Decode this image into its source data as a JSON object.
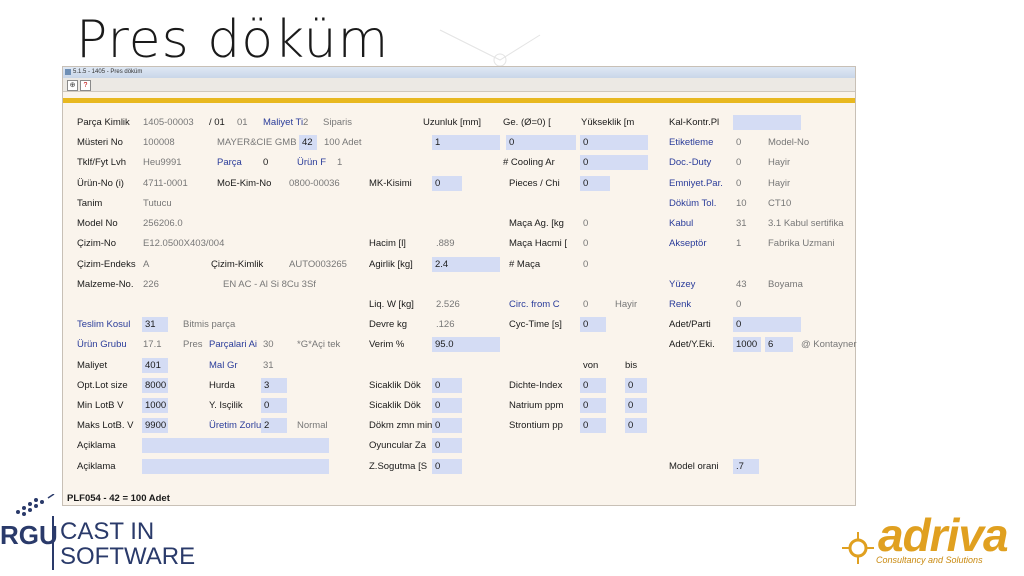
{
  "slide": {
    "title": "Pres döküm"
  },
  "window": {
    "title": "5.1.5 - 1405 - Pres döküm"
  },
  "toolbar": {
    "btn1": "⊕",
    "btn2": "?"
  },
  "labels": {
    "parca_kimlik": "Parça Kimlik",
    "musteri_no": "Müsteri No",
    "tklf_fyt_lvh": "Tklf/Fyt Lvh",
    "urun_no": "Ürün-No (i)",
    "tanim": "Tanim",
    "model_no": "Model No",
    "cizim_no": "Çizim-No",
    "cizim_endeks": "Çizim-Endeks",
    "malzeme_no": "Malzeme-No.",
    "teslim_kosul": "Teslim Kosul",
    "urun_grubu": "Ürün Grubu",
    "maliyet": "Maliyet",
    "opt_lot": "Opt.Lot size",
    "min_lot": "Min LotB V",
    "maks_lot": "Maks LotB. V",
    "aciklama1": "Açiklama",
    "aciklama2": "Açiklama",
    "maliyet_ti": "Maliyet Ti",
    "moe_kim": "MoE-Kim-No",
    "parca": "Parça",
    "urun_f": "Ürün F",
    "cizim_kimlik": "Çizim-Kimlik",
    "parcalari_ai": "Parçalari Ai",
    "mal_gr": "Mal Gr",
    "hurda": "Hurda",
    "y_iscilik": "Y. Isçilik",
    "uretim_zorlu": "Üretim Zorlu",
    "uzunluk": "Uzunluk [mm]",
    "mk_kisimi": "MK-Kisimi",
    "hacim": "Hacim [l]",
    "agirlik": "Agirlik [kg]",
    "liq_w": "Liq. W [kg]",
    "devre_kg": "Devre kg",
    "verim": "Verim %",
    "sicaklik1": "Sicaklik Dök",
    "sicaklik2": "Sicaklik Dök",
    "dokm_zmn": "Dökm zmn min",
    "oyuncular": "Oyuncular Za",
    "z_sogutma": "Z.Sogutma [S",
    "ge": "Ge.  (Ø=0) [",
    "cooling": "# Cooling Ar",
    "pieces": "Pieces / Chi",
    "maca_ag": "Maça Ag. [kg",
    "maca_hacmi": "Maça Hacmi [",
    "maca": "# Maça",
    "circ": "Circ. from C",
    "cyc_time": "Cyc-Time [s]",
    "dichte": "Dichte-Index",
    "natrium": "Natrium ppm",
    "strontium": "Strontium pp",
    "von": "von",
    "bis": "bis",
    "yukseklik": "Yükseklik [m",
    "kal_kontr": "Kal-Kontr.Pl",
    "etiketleme": "Etiketleme",
    "doc_duty": "Doc.-Duty",
    "emniyet": "Emniyet.Par.",
    "dokum_tol": "Döküm Tol.",
    "kabul": "Kabul",
    "akseptor": "Akseptör",
    "yuzey": "Yüzey",
    "renk": "Renk",
    "adet_parti": "Adet/Parti",
    "adet_y_eki": "Adet/Y.Eki.",
    "model_orani": "Model orani"
  },
  "values": {
    "parca_kimlik": "1405-00003",
    "parca_kimlik_2": "/ 01",
    "parca_kimlik_3": "01",
    "maliyet_ti_suffix": "2",
    "siparis": "Siparis",
    "musteri_no": "100008",
    "musteri_name": "MAYER&CIE GMB",
    "musteri_qty": "42",
    "adet": "100 Adet",
    "tklf": "Heu9991",
    "parca_val": "0",
    "urun_f_val": "1",
    "urun_no": "4711-0001",
    "moe_kim": "0800-00036",
    "tanim": "Tutucu",
    "model_no": "256206.0",
    "cizim_no": "E12.0500X403/004",
    "cizim_endeks": "A",
    "cizim_kimlik": "AUTO003265",
    "malzeme_no": "226",
    "malzeme_desc": "EN AC - Al Si 8Cu 3Sf",
    "teslim_kosul": "31",
    "teslim_desc": "Bitmis parça",
    "urun_grubu": "17.1",
    "pres": "Pres",
    "parcalari_ai": "30",
    "aci": "*G*Açi tek",
    "maliyet": "401",
    "mal_gr": "31",
    "opt_lot": "8000",
    "hurda": "3",
    "min_lot": "1000",
    "y_iscilik": "0",
    "maks_lot": "9900",
    "uretim_zorlu": "2",
    "normal": "Normal",
    "uzunluk_fld": "1",
    "mk_kisimi": "0",
    "hacim": ".889",
    "agirlik": "2.4",
    "liq_w": "2.526",
    "devre_kg": ".126",
    "verim": "95.0",
    "sicaklik1": "0",
    "sicaklik2": "0",
    "dokm_zmn": "0",
    "oyuncular": "0",
    "z_sogutma": "0",
    "ge_fld": "0",
    "cooling": "0",
    "pieces": "0",
    "maca_ag": "0",
    "maca_hacmi": "0",
    "maca": "0",
    "circ": "0",
    "hayir_circ": "Hayir",
    "cyc_time": "0",
    "dichte_von": "0",
    "dichte_bis": "0",
    "natrium_von": "0",
    "natrium_bis": "0",
    "strontium_von": "0",
    "strontium_bis": "0",
    "etiketleme": "0",
    "model_no_txt": "Model-No",
    "doc_duty": "0",
    "hayir1": "Hayir",
    "emniyet": "0",
    "hayir2": "Hayir",
    "dokum_tol": "10",
    "ct10": "CT10",
    "kabul": "31",
    "kabul_desc": "3.1 Kabul sertifika",
    "akseptor": "1",
    "akseptor_desc": "Fabrika Uzmani",
    "yuzey": "43",
    "boyama": "Boyama",
    "renk": "0",
    "adet_parti": "0",
    "adet_y_eki": "1000",
    "adet_y_eki_2": "6",
    "kontayner": "@ Kontayner",
    "model_orani": ".7"
  },
  "footer": {
    "status": "PLF054 - 42 = 100 Adet"
  },
  "logos": {
    "left_abbr": "RGU",
    "left_line1": "CAST IN",
    "left_line2": "SOFTWARE",
    "right_word": "adriva",
    "right_sub": "Consultancy and Solutions"
  },
  "colors": {
    "field_bg": "#d4dcf4",
    "link": "#2a3c9a",
    "accent_bar": "#e8b820",
    "brand_orange": "#e0a020"
  }
}
